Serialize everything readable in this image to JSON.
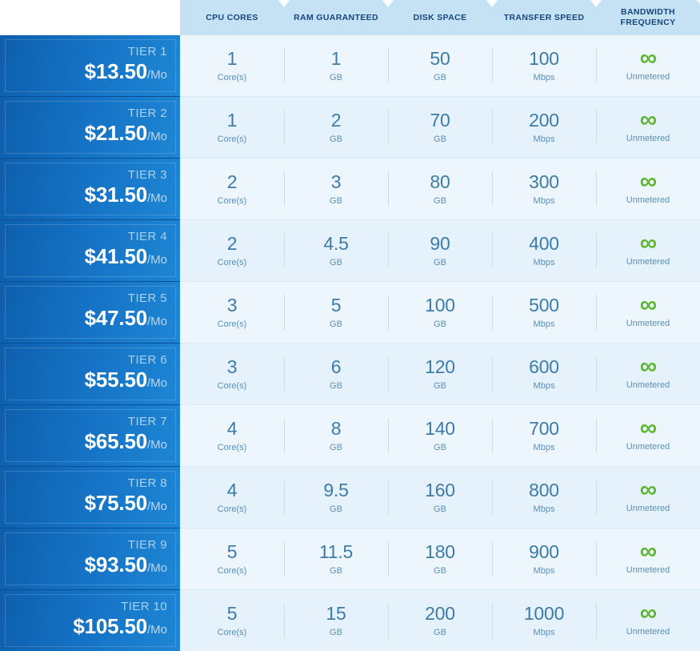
{
  "table": {
    "columns": [
      {
        "key": "cpu",
        "label": "CPU CORES"
      },
      {
        "key": "ram",
        "label": "RAM GUARANTEED"
      },
      {
        "key": "disk",
        "label": "DISK SPACE"
      },
      {
        "key": "transfer",
        "label": "TRANSFER SPEED"
      },
      {
        "key": "bandwidth",
        "label": "BANDWIDTH FREQUENCY"
      }
    ],
    "currency_symbol": "$",
    "period_label": "/Mo",
    "infinity_glyph": "∞",
    "accent_blue": "#1572c4",
    "header_bg": "#c5e2f4",
    "header_text_color": "#15477c",
    "value_color": "#3d7ba8",
    "infinity_color": "#5cb82e",
    "row_bg_even": "#e6f2fb",
    "row_bg_odd": "#edf6fc",
    "rows": [
      {
        "tier": "TIER 1",
        "price": "$13.50",
        "period": "/Mo",
        "cells": [
          {
            "value": "1",
            "unit": "Core(s)"
          },
          {
            "value": "1",
            "unit": "GB"
          },
          {
            "value": "50",
            "unit": "GB"
          },
          {
            "value": "100",
            "unit": "Mbps"
          },
          {
            "value": "∞",
            "unit": "Unmetered",
            "infinite": true
          }
        ]
      },
      {
        "tier": "TIER 2",
        "price": "$21.50",
        "period": "/Mo",
        "cells": [
          {
            "value": "1",
            "unit": "Core(s)"
          },
          {
            "value": "2",
            "unit": "GB"
          },
          {
            "value": "70",
            "unit": "GB"
          },
          {
            "value": "200",
            "unit": "Mbps"
          },
          {
            "value": "∞",
            "unit": "Unmetered",
            "infinite": true
          }
        ]
      },
      {
        "tier": "TIER 3",
        "price": "$31.50",
        "period": "/Mo",
        "cells": [
          {
            "value": "2",
            "unit": "Core(s)"
          },
          {
            "value": "3",
            "unit": "GB"
          },
          {
            "value": "80",
            "unit": "GB"
          },
          {
            "value": "300",
            "unit": "Mbps"
          },
          {
            "value": "∞",
            "unit": "Unmetered",
            "infinite": true
          }
        ]
      },
      {
        "tier": "TIER 4",
        "price": "$41.50",
        "period": "/Mo",
        "cells": [
          {
            "value": "2",
            "unit": "Core(s)"
          },
          {
            "value": "4.5",
            "unit": "GB"
          },
          {
            "value": "90",
            "unit": "GB"
          },
          {
            "value": "400",
            "unit": "Mbps"
          },
          {
            "value": "∞",
            "unit": "Unmetered",
            "infinite": true
          }
        ]
      },
      {
        "tier": "TIER 5",
        "price": "$47.50",
        "period": "/Mo",
        "cells": [
          {
            "value": "3",
            "unit": "Core(s)"
          },
          {
            "value": "5",
            "unit": "GB"
          },
          {
            "value": "100",
            "unit": "GB"
          },
          {
            "value": "500",
            "unit": "Mbps"
          },
          {
            "value": "∞",
            "unit": "Unmetered",
            "infinite": true
          }
        ]
      },
      {
        "tier": "TIER 6",
        "price": "$55.50",
        "period": "/Mo",
        "cells": [
          {
            "value": "3",
            "unit": "Core(s)"
          },
          {
            "value": "6",
            "unit": "GB"
          },
          {
            "value": "120",
            "unit": "GB"
          },
          {
            "value": "600",
            "unit": "Mbps"
          },
          {
            "value": "∞",
            "unit": "Unmetered",
            "infinite": true
          }
        ]
      },
      {
        "tier": "TIER 7",
        "price": "$65.50",
        "period": "/Mo",
        "cells": [
          {
            "value": "4",
            "unit": "Core(s)"
          },
          {
            "value": "8",
            "unit": "GB"
          },
          {
            "value": "140",
            "unit": "GB"
          },
          {
            "value": "700",
            "unit": "Mbps"
          },
          {
            "value": "∞",
            "unit": "Unmetered",
            "infinite": true
          }
        ]
      },
      {
        "tier": "TIER 8",
        "price": "$75.50",
        "period": "/Mo",
        "cells": [
          {
            "value": "4",
            "unit": "Core(s)"
          },
          {
            "value": "9.5",
            "unit": "GB"
          },
          {
            "value": "160",
            "unit": "GB"
          },
          {
            "value": "800",
            "unit": "Mbps"
          },
          {
            "value": "∞",
            "unit": "Unmetered",
            "infinite": true
          }
        ]
      },
      {
        "tier": "TIER 9",
        "price": "$93.50",
        "period": "/Mo",
        "cells": [
          {
            "value": "5",
            "unit": "Core(s)"
          },
          {
            "value": "11.5",
            "unit": "GB"
          },
          {
            "value": "180",
            "unit": "GB"
          },
          {
            "value": "900",
            "unit": "Mbps"
          },
          {
            "value": "∞",
            "unit": "Unmetered",
            "infinite": true
          }
        ]
      },
      {
        "tier": "TIER 10",
        "price": "$105.50",
        "period": "/Mo",
        "cells": [
          {
            "value": "5",
            "unit": "Core(s)"
          },
          {
            "value": "15",
            "unit": "GB"
          },
          {
            "value": "200",
            "unit": "GB"
          },
          {
            "value": "1000",
            "unit": "Mbps"
          },
          {
            "value": "∞",
            "unit": "Unmetered",
            "infinite": true
          }
        ]
      }
    ]
  }
}
